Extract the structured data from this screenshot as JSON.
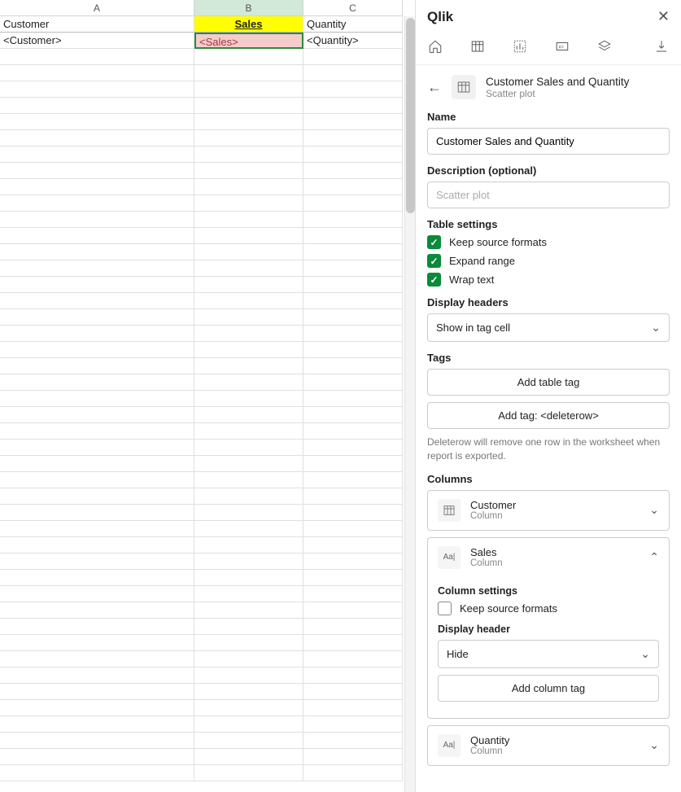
{
  "panel": {
    "title": "Qlik",
    "crumb": {
      "title": "Customer Sales and Quantity",
      "subtitle": "Scatter plot"
    },
    "name": {
      "label": "Name",
      "value": "Customer Sales and Quantity"
    },
    "description": {
      "label": "Description (optional)",
      "placeholder": "Scatter plot"
    },
    "tableSettings": {
      "label": "Table settings",
      "keepFormats": "Keep source formats",
      "expandRange": "Expand range",
      "wrapText": "Wrap text"
    },
    "displayHeaders": {
      "label": "Display headers",
      "value": "Show in tag cell"
    },
    "tags": {
      "label": "Tags",
      "addTable": "Add table tag",
      "addDeleteRow": "Add tag: <deleterow>",
      "hint": "Deleterow will remove one row in the worksheet when report is exported."
    },
    "columnsLabel": "Columns",
    "cols": {
      "customer": {
        "name": "Customer",
        "sub": "Column"
      },
      "sales": {
        "name": "Sales",
        "sub": "Column",
        "colSettingsLabel": "Column settings",
        "keepFormats": "Keep source formats",
        "displayHeaderLabel": "Display header",
        "displayHeaderValue": "Hide",
        "addTag": "Add column tag"
      },
      "quantity": {
        "name": "Quantity",
        "sub": "Column"
      }
    }
  },
  "sheet": {
    "colLabels": [
      "A",
      "B",
      "C"
    ],
    "headers": {
      "customer": "Customer",
      "sales": "Sales",
      "quantity": "Quantity"
    },
    "tags": {
      "customer": "<Customer>",
      "sales": "<Sales>",
      "quantity": "<Quantity>"
    }
  }
}
